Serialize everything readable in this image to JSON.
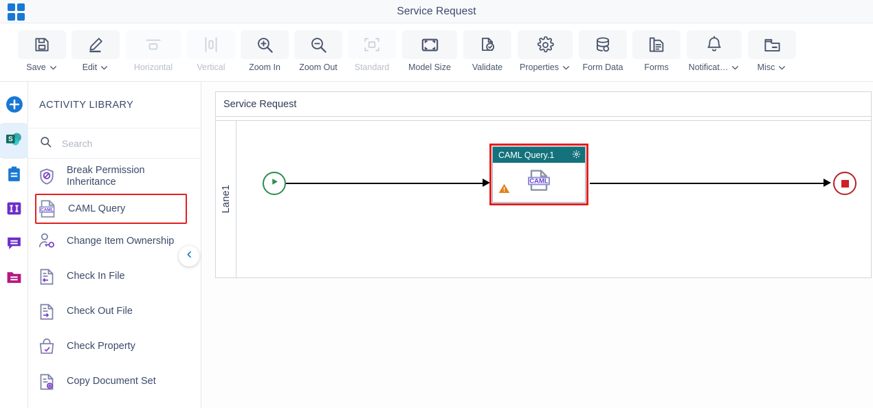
{
  "titlebar": {
    "app_logo": "grid-apps-icon",
    "title": "Service Request"
  },
  "toolbar": {
    "items": [
      {
        "id": "save",
        "label": "Save",
        "icon": "save-disk-icon",
        "caret": true,
        "disabled": false
      },
      {
        "id": "edit",
        "label": "Edit",
        "icon": "pencil-edit-icon",
        "caret": true,
        "disabled": false
      },
      {
        "id": "horizontal",
        "label": "Horizontal",
        "icon": "horizontal-align-icon",
        "caret": false,
        "disabled": true
      },
      {
        "id": "vertical",
        "label": "Vertical",
        "icon": "vertical-align-icon",
        "caret": false,
        "disabled": true
      },
      {
        "id": "zoom-in",
        "label": "Zoom In",
        "icon": "zoom-in-icon",
        "caret": false,
        "disabled": false
      },
      {
        "id": "zoom-out",
        "label": "Zoom Out",
        "icon": "zoom-out-icon",
        "caret": false,
        "disabled": false
      },
      {
        "id": "standard",
        "label": "Standard",
        "icon": "standard-size-icon",
        "caret": false,
        "disabled": true
      },
      {
        "id": "model-size",
        "label": "Model Size",
        "icon": "model-size-icon",
        "caret": false,
        "disabled": false
      },
      {
        "id": "validate",
        "label": "Validate",
        "icon": "validate-doc-icon",
        "caret": false,
        "disabled": false
      },
      {
        "id": "properties",
        "label": "Properties",
        "icon": "gear-icon",
        "caret": true,
        "disabled": false
      },
      {
        "id": "form-data",
        "label": "Form Data",
        "icon": "database-icon",
        "caret": false,
        "disabled": false
      },
      {
        "id": "forms",
        "label": "Forms",
        "icon": "documents-icon",
        "caret": false,
        "disabled": false
      },
      {
        "id": "notifications",
        "label": "Notificat…",
        "icon": "bell-icon",
        "caret": true,
        "disabled": false
      },
      {
        "id": "misc",
        "label": "Misc",
        "icon": "folder-minus-icon",
        "caret": true,
        "disabled": false
      }
    ]
  },
  "rail": {
    "items": [
      {
        "id": "add",
        "icon": "plus-circle-icon",
        "active": false
      },
      {
        "id": "sharepoint",
        "icon": "sharepoint-icon",
        "active": true
      },
      {
        "id": "tasks",
        "icon": "clipboard-icon",
        "active": false
      },
      {
        "id": "columns",
        "icon": "columns-icon",
        "active": false
      },
      {
        "id": "comments",
        "icon": "comment-icon",
        "active": false
      },
      {
        "id": "files",
        "icon": "folder-icon",
        "active": false
      }
    ]
  },
  "library": {
    "header": "ACTIVITY LIBRARY",
    "search": {
      "placeholder": "Search",
      "value": "",
      "icon": "search-icon"
    },
    "collapse_icon": "chevron-left-icon",
    "items": [
      {
        "id": "break-permission-inheritance",
        "label": "Break Permission Inheritance",
        "icon": "shield-block-icon",
        "selected": false
      },
      {
        "id": "caml-query",
        "label": "CAML Query",
        "icon": "caml-document-icon",
        "selected": true
      },
      {
        "id": "change-item-ownership",
        "label": "Change Item Ownership",
        "icon": "person-key-icon",
        "selected": false
      },
      {
        "id": "check-in-file",
        "label": "Check In File",
        "icon": "document-in-icon",
        "selected": false
      },
      {
        "id": "check-out-file",
        "label": "Check Out File",
        "icon": "document-out-icon",
        "selected": false
      },
      {
        "id": "check-property",
        "label": "Check Property",
        "icon": "bag-check-icon",
        "selected": false
      },
      {
        "id": "copy-document-set",
        "label": "Copy Document Set",
        "icon": "document-gear-icon",
        "selected": false
      }
    ]
  },
  "canvas": {
    "pool_title": "Service Request",
    "lane_label": "Lane1",
    "nodes": [
      {
        "id": "start-event",
        "type": "start",
        "label": "",
        "icon": "play-triangle-icon"
      },
      {
        "id": "caml-query-1",
        "type": "task",
        "label": "CAML Query.1",
        "icon": "caml-document-icon",
        "gear_icon": "gear-icon",
        "warning_icon": "warning-triangle-icon"
      },
      {
        "id": "end-event",
        "type": "end",
        "label": "",
        "icon": "stop-square-icon"
      }
    ]
  },
  "colors": {
    "accent_blue": "#1878d2",
    "selection_red": "#e02020",
    "task_header_teal": "#13727c",
    "start_green": "#2e8b50",
    "end_red": "#b52026",
    "warning_orange": "#e2801a",
    "icon_purple": "#7a3ecc",
    "text_slate": "#3b4a6b"
  }
}
